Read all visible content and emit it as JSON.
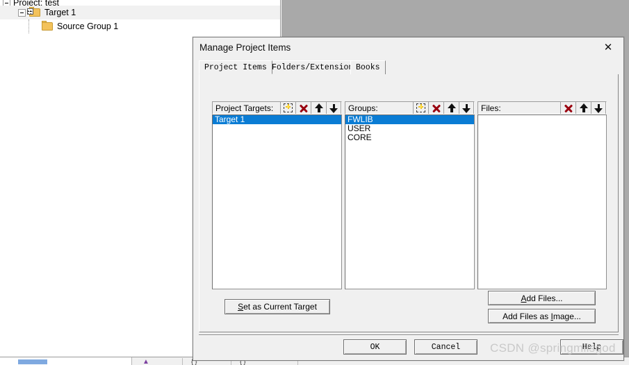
{
  "ide": {
    "tree": {
      "project_row_label": "Project: test",
      "items": [
        {
          "label": "Target 1",
          "icon": "folder-flag-icon",
          "expander": "collapse-box",
          "selected": true
        },
        {
          "label": "Source Group 1",
          "icon": "folder-icon",
          "expander": "",
          "selected": false
        }
      ]
    },
    "statusbar": {
      "tab_label": "",
      "icon1": "▲",
      "icon2": "{ }",
      "icon3": "{ }"
    }
  },
  "dialog": {
    "title": "Manage Project Items",
    "close_label": "✕",
    "tabs": [
      {
        "label": "Project Items",
        "active": true
      },
      {
        "label": "Folders/Extensions",
        "active": false
      },
      {
        "label": "Books",
        "active": false
      }
    ],
    "panels": {
      "project_targets": {
        "header_label": "Project Targets:",
        "icons": [
          "new-item-icon",
          "delete-icon",
          "move-up-icon",
          "move-down-icon"
        ],
        "items": [
          {
            "label": "Target 1",
            "selected": true
          }
        ]
      },
      "groups": {
        "header_label": "Groups:",
        "icons": [
          "new-item-icon",
          "delete-icon",
          "move-up-icon",
          "move-down-icon"
        ],
        "items": [
          {
            "label": "FWLIB",
            "selected": true
          },
          {
            "label": "USER",
            "selected": false
          },
          {
            "label": "CORE",
            "selected": false
          }
        ]
      },
      "files": {
        "header_label": "Files:",
        "icons": [
          "delete-icon",
          "move-up-icon",
          "move-down-icon"
        ],
        "items": []
      }
    },
    "buttons": {
      "set_as_current_target": {
        "accel": "S",
        "rest": "et as Current Target"
      },
      "add_files": {
        "accel": "A",
        "pre": "",
        "rest": "dd Files..."
      },
      "add_files_as_image": {
        "pre": "Add Files as ",
        "accel": "I",
        "rest": "mage..."
      },
      "ok": "OK",
      "cancel": "Cancel",
      "help": "Help"
    }
  },
  "watermark": {
    "text": "CSDN @springmlisgod"
  },
  "colors": {
    "selection_blue": "#0a7cd4",
    "dialog_face": "#f0f0f0",
    "editor_gray": "#a9a9a9",
    "delete_red": "#99000f",
    "folder_yellow": "#f3c25b"
  }
}
